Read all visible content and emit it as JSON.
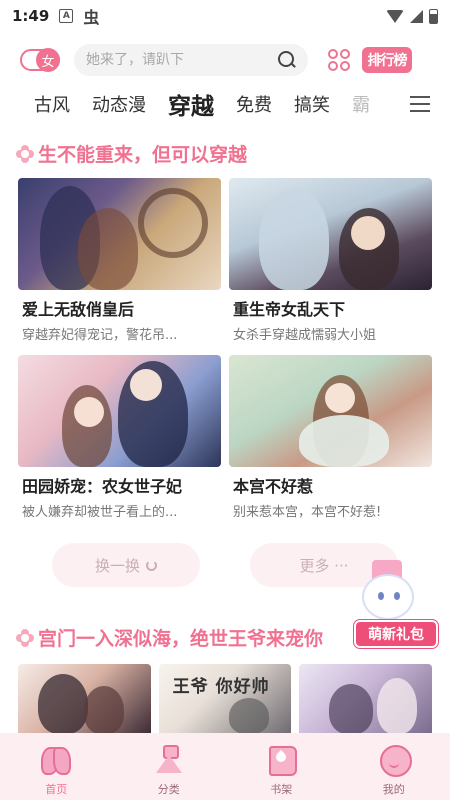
{
  "status_bar": {
    "time": "1:49",
    "badge": "A",
    "extra_glyph": "虫"
  },
  "header": {
    "gender_label": "女",
    "search_placeholder": "她来了，请趴下",
    "rank_label": "排行榜",
    "accent_color": "#f07290"
  },
  "tabs": {
    "items": [
      "古风",
      "动态漫",
      "穿越",
      "免费",
      "搞笑",
      "霸"
    ],
    "active": "穿越"
  },
  "section1": {
    "title": "生不能重来，但可以穿越",
    "books": [
      {
        "name": "爱上无敌俏皇后",
        "desc": "穿越弃妃得宠记，警花吊..."
      },
      {
        "name": "重生帝女乱天下",
        "desc": "女杀手穿越成懦弱大小姐"
      },
      {
        "name": "田园娇宠：农女世子妃",
        "desc": "被人嫌弃却被世子看上的..."
      },
      {
        "name": "本宫不好惹",
        "desc": "别来惹本宫，本宫不好惹!"
      }
    ],
    "refresh_label": "换一换",
    "more_label": "更多 ···"
  },
  "gift_label": "萌新礼包",
  "section2": {
    "title": "宫门一入深似海，绝世王爷来宠你",
    "cover_brush_text": "王爷 你好帅"
  },
  "bottom_nav": {
    "items": [
      {
        "label": "首页",
        "icon": "butterfly-icon"
      },
      {
        "label": "分类",
        "icon": "dress-icon"
      },
      {
        "label": "书架",
        "icon": "book-icon"
      },
      {
        "label": "我的",
        "icon": "face-icon"
      }
    ],
    "active": "首页"
  }
}
